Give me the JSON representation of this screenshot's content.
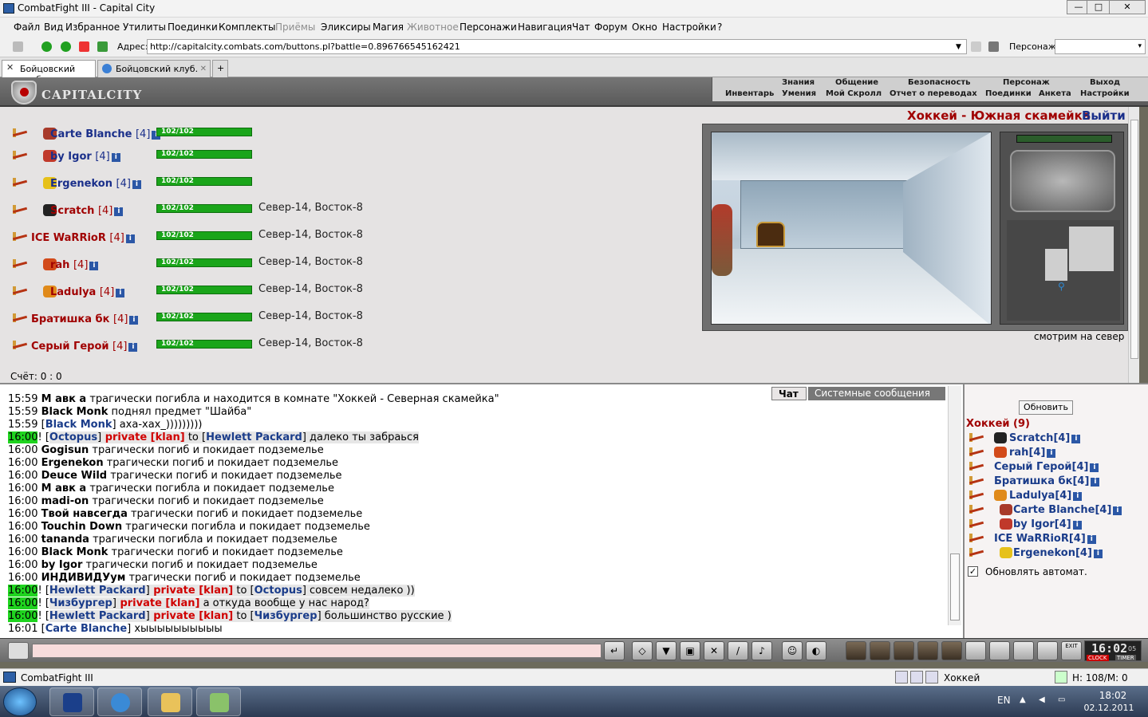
{
  "window": {
    "title": "CombatFight III - Capital City",
    "min": "—",
    "max": "□",
    "close": "✕"
  },
  "menu": [
    "Файл",
    "Вид",
    "Избранное",
    "Утилиты",
    "Поединки",
    "Комплекты",
    "Приёмы",
    "Эликсиры",
    "Магия",
    "Животное",
    "Персонажи",
    "Навигация",
    "Чат",
    "Форум",
    "Окно",
    "Настройки",
    "?"
  ],
  "address": {
    "label": "Адрес:",
    "url": "http://capitalcity.combats.com/buttons.pl?battle=0.896766545162421",
    "character_label": "Персонаж:",
    "character_value": "▾"
  },
  "tabs": [
    {
      "label": "Бойцовский клуб"
    },
    {
      "label": "Бойцовский клуб."
    }
  ],
  "header": {
    "logo": "CAPITALCITY",
    "nav_top": [
      "Знания",
      "Общение",
      "Безопасность",
      "Персонаж",
      "Выход"
    ],
    "nav_bottom": [
      "Инвентарь",
      "Умения",
      "Мой Скролл",
      "Отчет о переводах",
      "Поединки",
      "Анкета",
      "Настройки"
    ]
  },
  "battle": {
    "room": "Хоккей - Южная скамейка",
    "exit": "Выйти",
    "players": [
      {
        "name": "Carte Blanche",
        "level": "[4]",
        "hp": "102/102",
        "location": "",
        "team": "blue",
        "clan_color": "#a83a2a"
      },
      {
        "name": "by Igor",
        "level": "[4]",
        "hp": "102/102",
        "location": "",
        "team": "blue",
        "clan_color": "#c0392b"
      },
      {
        "name": "Ergenekon",
        "level": "[4]",
        "hp": "102/102",
        "location": "",
        "team": "blue",
        "clan_color": "#e6c11a"
      },
      {
        "name": "Scratch",
        "level": "[4]",
        "hp": "102/102",
        "location": "Север-14, Восток-8",
        "team": "red",
        "clan_color": "#222222"
      },
      {
        "name": "ICE WaRRioR",
        "level": "[4]",
        "hp": "102/102",
        "location": "Север-14, Восток-8",
        "team": "red",
        "clan_color": ""
      },
      {
        "name": "rah",
        "level": "[4]",
        "hp": "102/102",
        "location": "Север-14, Восток-8",
        "team": "red",
        "clan_color": "#d24a1a"
      },
      {
        "name": "Ladulya",
        "level": "[4]",
        "hp": "102/102",
        "location": "Север-14, Восток-8",
        "team": "red",
        "clan_color": "#e08a1a"
      },
      {
        "name": "Братишка бк",
        "level": "[4]",
        "hp": "102/102",
        "location": "Север-14, Восток-8",
        "team": "red",
        "clan_color": ""
      },
      {
        "name": "Серый Герой",
        "level": "[4]",
        "hp": "102/102",
        "location": "Север-14, Восток-8",
        "team": "red",
        "clan_color": ""
      }
    ],
    "score": "Счёт: 0 : 0",
    "look_direction": "смотрим на север"
  },
  "chat": {
    "tab_chat": "Чат",
    "tab_system": "Системные сообщения",
    "lines": [
      {
        "time": "15:59",
        "hl": false,
        "pre": "",
        "a": "М авк а",
        "a_style": "b",
        "rest": " трагически погибла и находится в комнате \"Хоккей - Северная скамейка\""
      },
      {
        "time": "15:59",
        "hl": false,
        "pre": "",
        "a": "Black Monk",
        "a_style": "b",
        "rest": " поднял предмет \"Шайба\""
      },
      {
        "time": "15:59",
        "hl": false,
        "pre": " [",
        "a": "Black Monk",
        "a_style": "nick",
        "rest": "] аха-хах_)))))))))"
      },
      {
        "time": "16:00",
        "hl": true,
        "pre": "! [",
        "a": "Octopus",
        "a_style": "nick",
        "priv": " private [klan]",
        "to": " to [",
        "b": "Hewlett Packard",
        "rest": "] далеко ты забраься"
      },
      {
        "time": "16:00",
        "hl": false,
        "pre": "",
        "a": "Gogisun",
        "a_style": "b",
        "rest": " трагически погиб и покидает подземелье"
      },
      {
        "time": "16:00",
        "hl": false,
        "pre": "",
        "a": "Ergenekon",
        "a_style": "b",
        "rest": " трагически погиб и покидает подземелье"
      },
      {
        "time": "16:00",
        "hl": false,
        "pre": "",
        "a": "Deuce Wild",
        "a_style": "b",
        "rest": " трагически погиб и покидает подземелье"
      },
      {
        "time": "16:00",
        "hl": false,
        "pre": "",
        "a": "М авк а",
        "a_style": "b",
        "rest": " трагически погибла и покидает подземелье"
      },
      {
        "time": "16:00",
        "hl": false,
        "pre": "",
        "a": "madi-on",
        "a_style": "b",
        "rest": " трагически погиб и покидает подземелье"
      },
      {
        "time": "16:00",
        "hl": false,
        "pre": "",
        "a": "Твой навсегда",
        "a_style": "b",
        "rest": " трагически погиб и покидает подземелье"
      },
      {
        "time": "16:00",
        "hl": false,
        "pre": "",
        "a": "Touchin Down",
        "a_style": "b",
        "rest": " трагически погибла и покидает подземелье"
      },
      {
        "time": "16:00",
        "hl": false,
        "pre": "",
        "a": "tananda",
        "a_style": "b",
        "rest": " трагически погибла и покидает подземелье"
      },
      {
        "time": "16:00",
        "hl": false,
        "pre": "",
        "a": "Black Monk",
        "a_style": "b",
        "rest": " трагически погиб и покидает подземелье"
      },
      {
        "time": "16:00",
        "hl": false,
        "pre": "",
        "a": "by Igor",
        "a_style": "b",
        "rest": " трагически погиб и покидает подземелье"
      },
      {
        "time": "16:00",
        "hl": false,
        "pre": "",
        "a": "ИНДИВИДУум",
        "a_style": "b",
        "rest": " трагически погиб и покидает подземелье"
      },
      {
        "time": "16:00",
        "hl": true,
        "pre": "! [",
        "a": "Hewlett Packard",
        "a_style": "nick",
        "priv": " private [klan]",
        "to": " to [",
        "b": "Octopus",
        "rest": "] совсем недалеко ))"
      },
      {
        "time": "16:00",
        "hl": true,
        "pre": "! [",
        "a": "Чизбургер",
        "a_style": "nick",
        "priv": " private [klan]",
        "rest": " а откуда вообще у нас народ?"
      },
      {
        "time": "16:00",
        "hl": true,
        "pre": "! [",
        "a": "Hewlett Packard",
        "a_style": "nick",
        "priv": " private [klan]",
        "to": " to [",
        "b": "Чизбургер",
        "rest": "] большинство русские )"
      },
      {
        "time": "16:01",
        "hl": false,
        "pre": " [",
        "a": "Carte Blanche",
        "a_style": "nick",
        "rest": "] хыыыыыыыыыы"
      }
    ]
  },
  "side": {
    "refresh": "Обновить",
    "team_title": "Хоккей (9)",
    "members": [
      {
        "name": "Scratch",
        "level": "[4]",
        "clan_color": "#222222"
      },
      {
        "name": "rah",
        "level": "[4]",
        "clan_color": "#d24a1a"
      },
      {
        "name": "Серый Герой",
        "level": "[4]",
        "clan_color": ""
      },
      {
        "name": "Братишка бк",
        "level": "[4]",
        "clan_color": ""
      },
      {
        "name": "Ladulya",
        "level": "[4]",
        "clan_color": "#e08a1a"
      },
      {
        "name": "Carte Blanche",
        "level": "[4]",
        "clan_color": "#a83a2a"
      },
      {
        "name": "by Igor",
        "level": "[4]",
        "clan_color": "#c0392b"
      },
      {
        "name": "ICE WaRRioR",
        "level": "[4]",
        "clan_color": ""
      },
      {
        "name": "Ergenekon",
        "level": "[4]",
        "clan_color": "#e6c11a"
      }
    ],
    "auto_refresh_label": "Обновлять автомат.",
    "auto_checked": "✓"
  },
  "bottom": {
    "clock_time": "16:02",
    "clock_sec": "05",
    "clock_label": "CLOCK",
    "timer_label": "TIMER",
    "exit_label": "EXIT"
  },
  "status": {
    "app": "CombatFight III",
    "room": "Хоккей",
    "hp": "H: 108/M: 0"
  },
  "taskbar": {
    "lang": "EN",
    "time": "18:02",
    "date": "02.12.2011"
  },
  "colors": {
    "accent_red": "#a00000",
    "accent_blue": "#1a3c8a",
    "hp_green": "#1aa51a",
    "chat_highlight": "#1fd41f"
  }
}
